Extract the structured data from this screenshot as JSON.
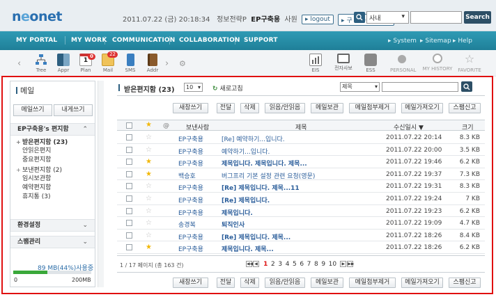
{
  "header": {
    "logo_text": "neonet",
    "user": {
      "datetime": "2011.07.22 (금) 20:18:34",
      "dept": "정보전략P",
      "name": "EP구축용",
      "rank": "사원"
    },
    "logout_label": "logout",
    "old_groupware_label": "구 그룹웨어 가기",
    "search": {
      "scope": "사내",
      "button_label": "Search"
    }
  },
  "nav": {
    "items": [
      "MY PORTAL",
      "MY WORK",
      "COMMUNICATION",
      "COLLABORATION",
      "SUPPORT"
    ],
    "right": [
      "System",
      "Sitemap",
      "Help"
    ]
  },
  "tools": {
    "left": [
      {
        "label": "Tree",
        "icon": "tree-icon",
        "badge": ""
      },
      {
        "label": "Appr",
        "icon": "approval-icon",
        "badge": ""
      },
      {
        "label": "Plan",
        "icon": "calendar-icon",
        "badge": "0",
        "day": "1"
      },
      {
        "label": "Mail",
        "icon": "mail-icon",
        "badge": "22"
      },
      {
        "label": "SMS",
        "icon": "sms-icon",
        "badge": ""
      },
      {
        "label": "Addr",
        "icon": "address-book-icon",
        "badge": ""
      }
    ],
    "right": [
      {
        "label": "EIS",
        "icon": "eis-icon"
      },
      {
        "label": "전자사보",
        "icon": "monitor-icon"
      },
      {
        "label": "ESS",
        "icon": "ess-icon"
      },
      {
        "label": "PERSONAL",
        "icon": "personal-icon"
      },
      {
        "label": "MY HISTORY",
        "icon": "history-icon"
      },
      {
        "label": "FAVORITE",
        "icon": "favorite-star-icon"
      }
    ]
  },
  "sidebar": {
    "title": "메일",
    "write_label": "메일쓰기",
    "self_write_label": "내게쓰기",
    "mailbox_section": "EP구축용's 편지함",
    "folders": [
      {
        "label": "받은편지함 (23)",
        "pm": "+",
        "bold": true
      },
      {
        "label": "안읽은편지",
        "pm": "",
        "bold": false
      },
      {
        "label": "중요편지함",
        "pm": "",
        "bold": false
      },
      {
        "label": "보낸편지함 (2)",
        "pm": "+",
        "bold": false
      },
      {
        "label": "임시보관함",
        "pm": "",
        "bold": false
      },
      {
        "label": "예약편지함",
        "pm": "",
        "bold": false
      },
      {
        "label": "휴지통 (3)",
        "pm": "",
        "bold": false
      }
    ],
    "settings_section": "환경설정",
    "spam_section": "스팸관리",
    "quota": {
      "text": "89 MB(44%)사용중",
      "percent": 44,
      "min": "0",
      "max": "200MB"
    }
  },
  "main": {
    "title": "받은편지함 (23)",
    "page_size": "10",
    "refresh_label": "새로고침",
    "filter_field": "제목",
    "actions": [
      "새창쓰기",
      "전달",
      "삭제",
      "읽음/안읽음",
      "메일보관",
      "메일첨부제거",
      "메일가져오기",
      "스팸신고"
    ],
    "columns": {
      "sender": "보낸사람",
      "subject": "제목",
      "date": "수신일시 ▼",
      "size": "크기"
    },
    "rows": [
      {
        "starred": false,
        "sender": "EP구축용",
        "subject": "[Re] 예약하기...입니다.",
        "bold": false,
        "date": "2011.07.22 20:14",
        "size": "8.3 KB"
      },
      {
        "starred": false,
        "sender": "EP구축용",
        "subject": "예약하기...입니다.",
        "bold": false,
        "date": "2011.07.22 20:00",
        "size": "3.5 KB"
      },
      {
        "starred": true,
        "sender": "EP구축용",
        "subject": "제목입니다. 제목입니다. 제목...",
        "bold": true,
        "date": "2011.07.22 19:46",
        "size": "6.2 KB"
      },
      {
        "starred": true,
        "sender": "백승호",
        "subject": "버그프리 기본 설정 관련 요청(영문)",
        "bold": false,
        "date": "2011.07.22 19:37",
        "size": "7.3 KB"
      },
      {
        "starred": false,
        "sender": "EP구축용",
        "subject": "[Re] 제목입니다. 제목...11",
        "bold": true,
        "date": "2011.07.22 19:31",
        "size": "8.3 KB"
      },
      {
        "starred": false,
        "sender": "EP구축용",
        "subject": "[Re] 제목입니다.",
        "bold": true,
        "date": "2011.07.22 19:24",
        "size": "7 KB"
      },
      {
        "starred": false,
        "sender": "EP구축용",
        "subject": "제목입니다.",
        "bold": true,
        "date": "2011.07.22 19:23",
        "size": "6.2 KB"
      },
      {
        "starred": false,
        "sender": "송경복",
        "subject": "퇴직인사",
        "bold": true,
        "date": "2011.07.22 19:09",
        "size": "4.7 KB"
      },
      {
        "starred": false,
        "sender": "EP구축용",
        "subject": "[Re] 제목입니다. 제목...",
        "bold": true,
        "date": "2011.07.22 18:26",
        "size": "8.4 KB"
      },
      {
        "starred": true,
        "sender": "EP구축용",
        "subject": "제목입니다. 제목...",
        "bold": true,
        "date": "2011.07.22 18:26",
        "size": "6.2 KB"
      }
    ],
    "page_info": "1 / 17 페이지 (총 163 건)",
    "pages": [
      "1",
      "2",
      "3",
      "4",
      "5",
      "6",
      "7",
      "8",
      "9",
      "10"
    ],
    "current_page": "1"
  }
}
